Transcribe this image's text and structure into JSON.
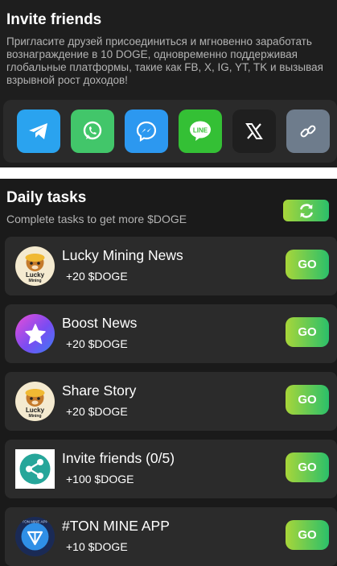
{
  "invite": {
    "title": "Invite friends",
    "description": "Пригласите друзей присоединиться и мгновенно заработать вознаграждение в 10 DOGE, одновременно поддерживая глобальные платформы, такие как FB, X, IG, YT, TK и вызывая взрывной рост доходов!",
    "share": [
      {
        "name": "telegram",
        "icon": "telegram-icon",
        "color": "#2aa3ef"
      },
      {
        "name": "whatsapp",
        "icon": "whatsapp-icon",
        "color": "#42c66a"
      },
      {
        "name": "messenger",
        "icon": "messenger-icon",
        "color": "#2c98f0"
      },
      {
        "name": "line",
        "icon": "line-icon",
        "color": "#34c035",
        "label": "LINE"
      },
      {
        "name": "x",
        "icon": "x-icon",
        "color": "#1f1f1f"
      },
      {
        "name": "copy-link",
        "icon": "link-icon",
        "color": "#6e7c8c"
      }
    ]
  },
  "daily": {
    "title": "Daily tasks",
    "subtitle": "Complete tasks to get more $DOGE",
    "refresh_icon": "refresh-icon",
    "tasks": [
      {
        "name": "Lucky Mining News",
        "reward": "+20 $DOGE",
        "icon": "lucky-mining-logo",
        "button": "GO"
      },
      {
        "name": "Boost News",
        "reward": "+20 $DOGE",
        "icon": "star-icon",
        "button": "GO"
      },
      {
        "name": "Share Story",
        "reward": "+20 $DOGE",
        "icon": "lucky-mining-logo",
        "button": "GO"
      },
      {
        "name": "Invite friends (0/5)",
        "reward": "+100 $DOGE",
        "icon": "share-icon",
        "button": "GO"
      },
      {
        "name": "#TON MINE APP",
        "reward": "+10 $DOGE",
        "icon": "ton-mine-logo",
        "button": "GO"
      }
    ],
    "logo_text": {
      "lucky": "Lucky",
      "mining": "Mining",
      "ton_ring": "TON MINE APP"
    }
  },
  "colors": {
    "accent_start": "#a8d63a",
    "accent_end": "#2bbf6a"
  }
}
